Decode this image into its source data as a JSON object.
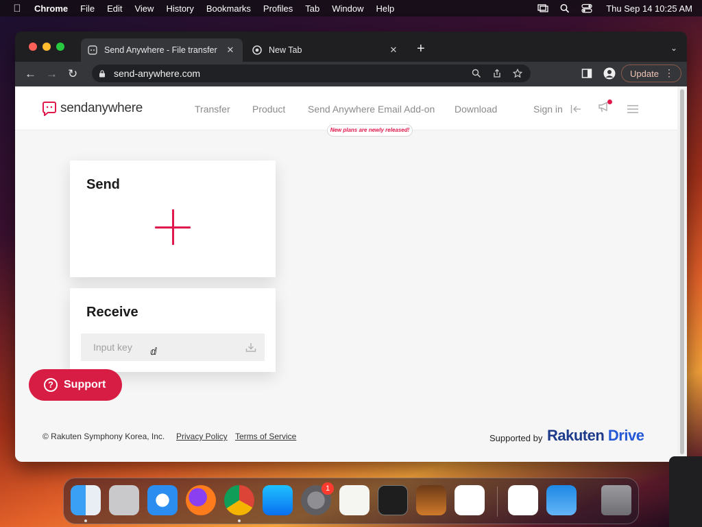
{
  "menubar": {
    "app_name": "Chrome",
    "items": [
      "File",
      "Edit",
      "View",
      "History",
      "Bookmarks",
      "Profiles",
      "Tab",
      "Window",
      "Help"
    ],
    "clock": "Thu Sep 14  10:25 AM"
  },
  "browser": {
    "tabs": [
      {
        "title": "Send Anywhere - File transfer",
        "active": true
      },
      {
        "title": "New Tab",
        "active": false
      }
    ],
    "url": "send-anywhere.com",
    "update_label": "Update"
  },
  "site": {
    "logo_text_a": "send",
    "logo_text_b": "anywhere",
    "nav": [
      "Transfer",
      "Product",
      "Send Anywhere Email Add-on",
      "Download"
    ],
    "promo": "New plans are newly released!",
    "sign_in": "Sign in",
    "send_title": "Send",
    "receive_title": "Receive",
    "key_placeholder": "Input key",
    "support_label": "Support",
    "footer": {
      "copyright": "© Rakuten Symphony Korea, Inc.",
      "privacy": "Privacy Policy",
      "terms": "Terms of Service",
      "supported_by": "Supported by",
      "brand_a": "Rakuten",
      "brand_b": "Drive"
    },
    "accent_color": "#e0184c"
  },
  "dock": {
    "apps": [
      "finder-icon",
      "launchpad-icon",
      "safari-icon",
      "firefox-icon",
      "chrome-icon",
      "app-store-icon",
      "system-settings-icon",
      "textedit-icon",
      "terminal-icon",
      "garageband-icon",
      "vscode-icon",
      "visual-studio-icon",
      "weather-icon",
      "trash-icon"
    ],
    "settings_badge": "1"
  }
}
